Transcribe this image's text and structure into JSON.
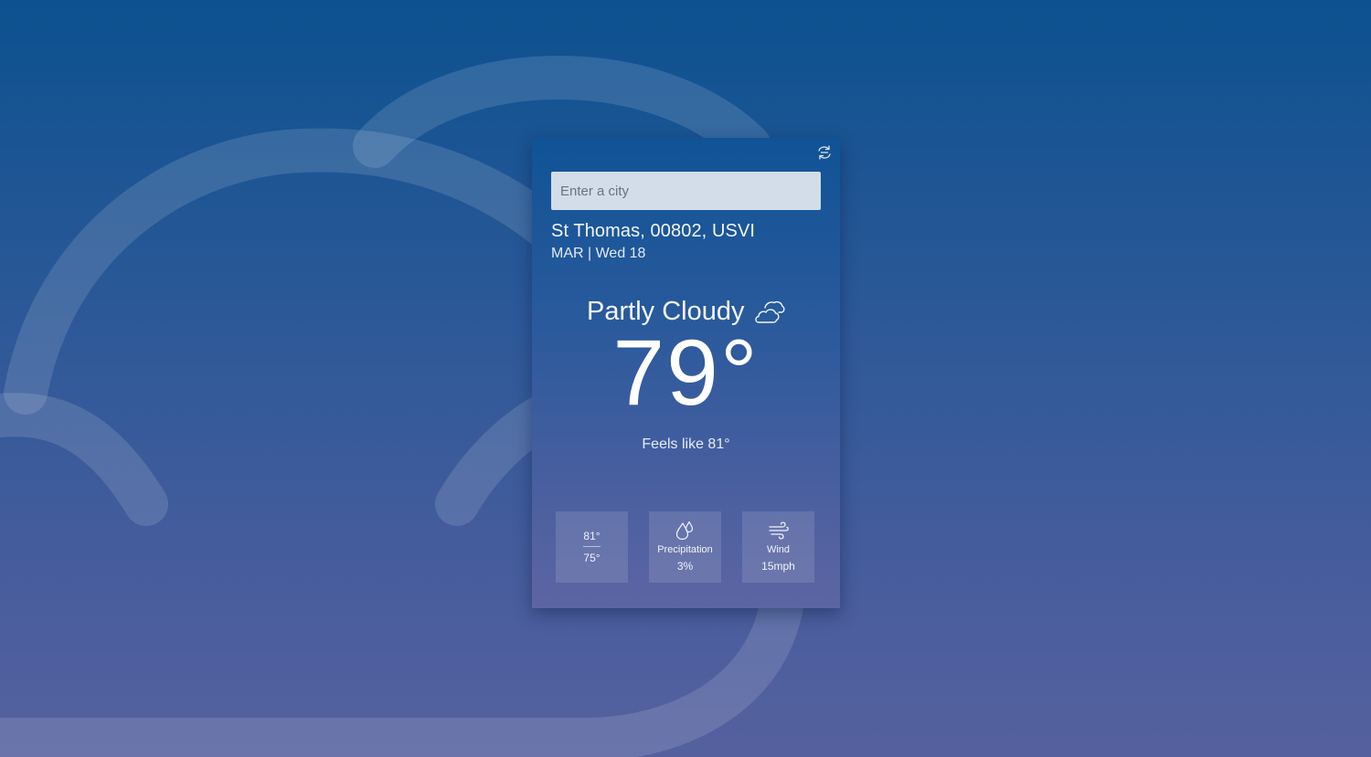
{
  "search": {
    "placeholder": "Enter a city"
  },
  "location": {
    "name": "St Thomas, 00802, USVI",
    "date": "MAR | Wed 18"
  },
  "current": {
    "condition": "Partly Cloudy",
    "condition_icon": "partly-cloudy-icon",
    "temperature": "79°",
    "feels_like": "Feels like 81°"
  },
  "tiles": {
    "high": "81°",
    "low": "75°",
    "precipitation_label": "Precipitation",
    "precipitation_value": "3%",
    "precipitation_icon": "raindrops-icon",
    "wind_label": "Wind",
    "wind_value": "15mph",
    "wind_icon": "wind-icon"
  },
  "toolbar": {
    "refresh_icon": "refresh-icon"
  },
  "colors": {
    "background_top": "#0c5190",
    "background_bottom": "#55619f",
    "search_field": "#d3dde9"
  }
}
